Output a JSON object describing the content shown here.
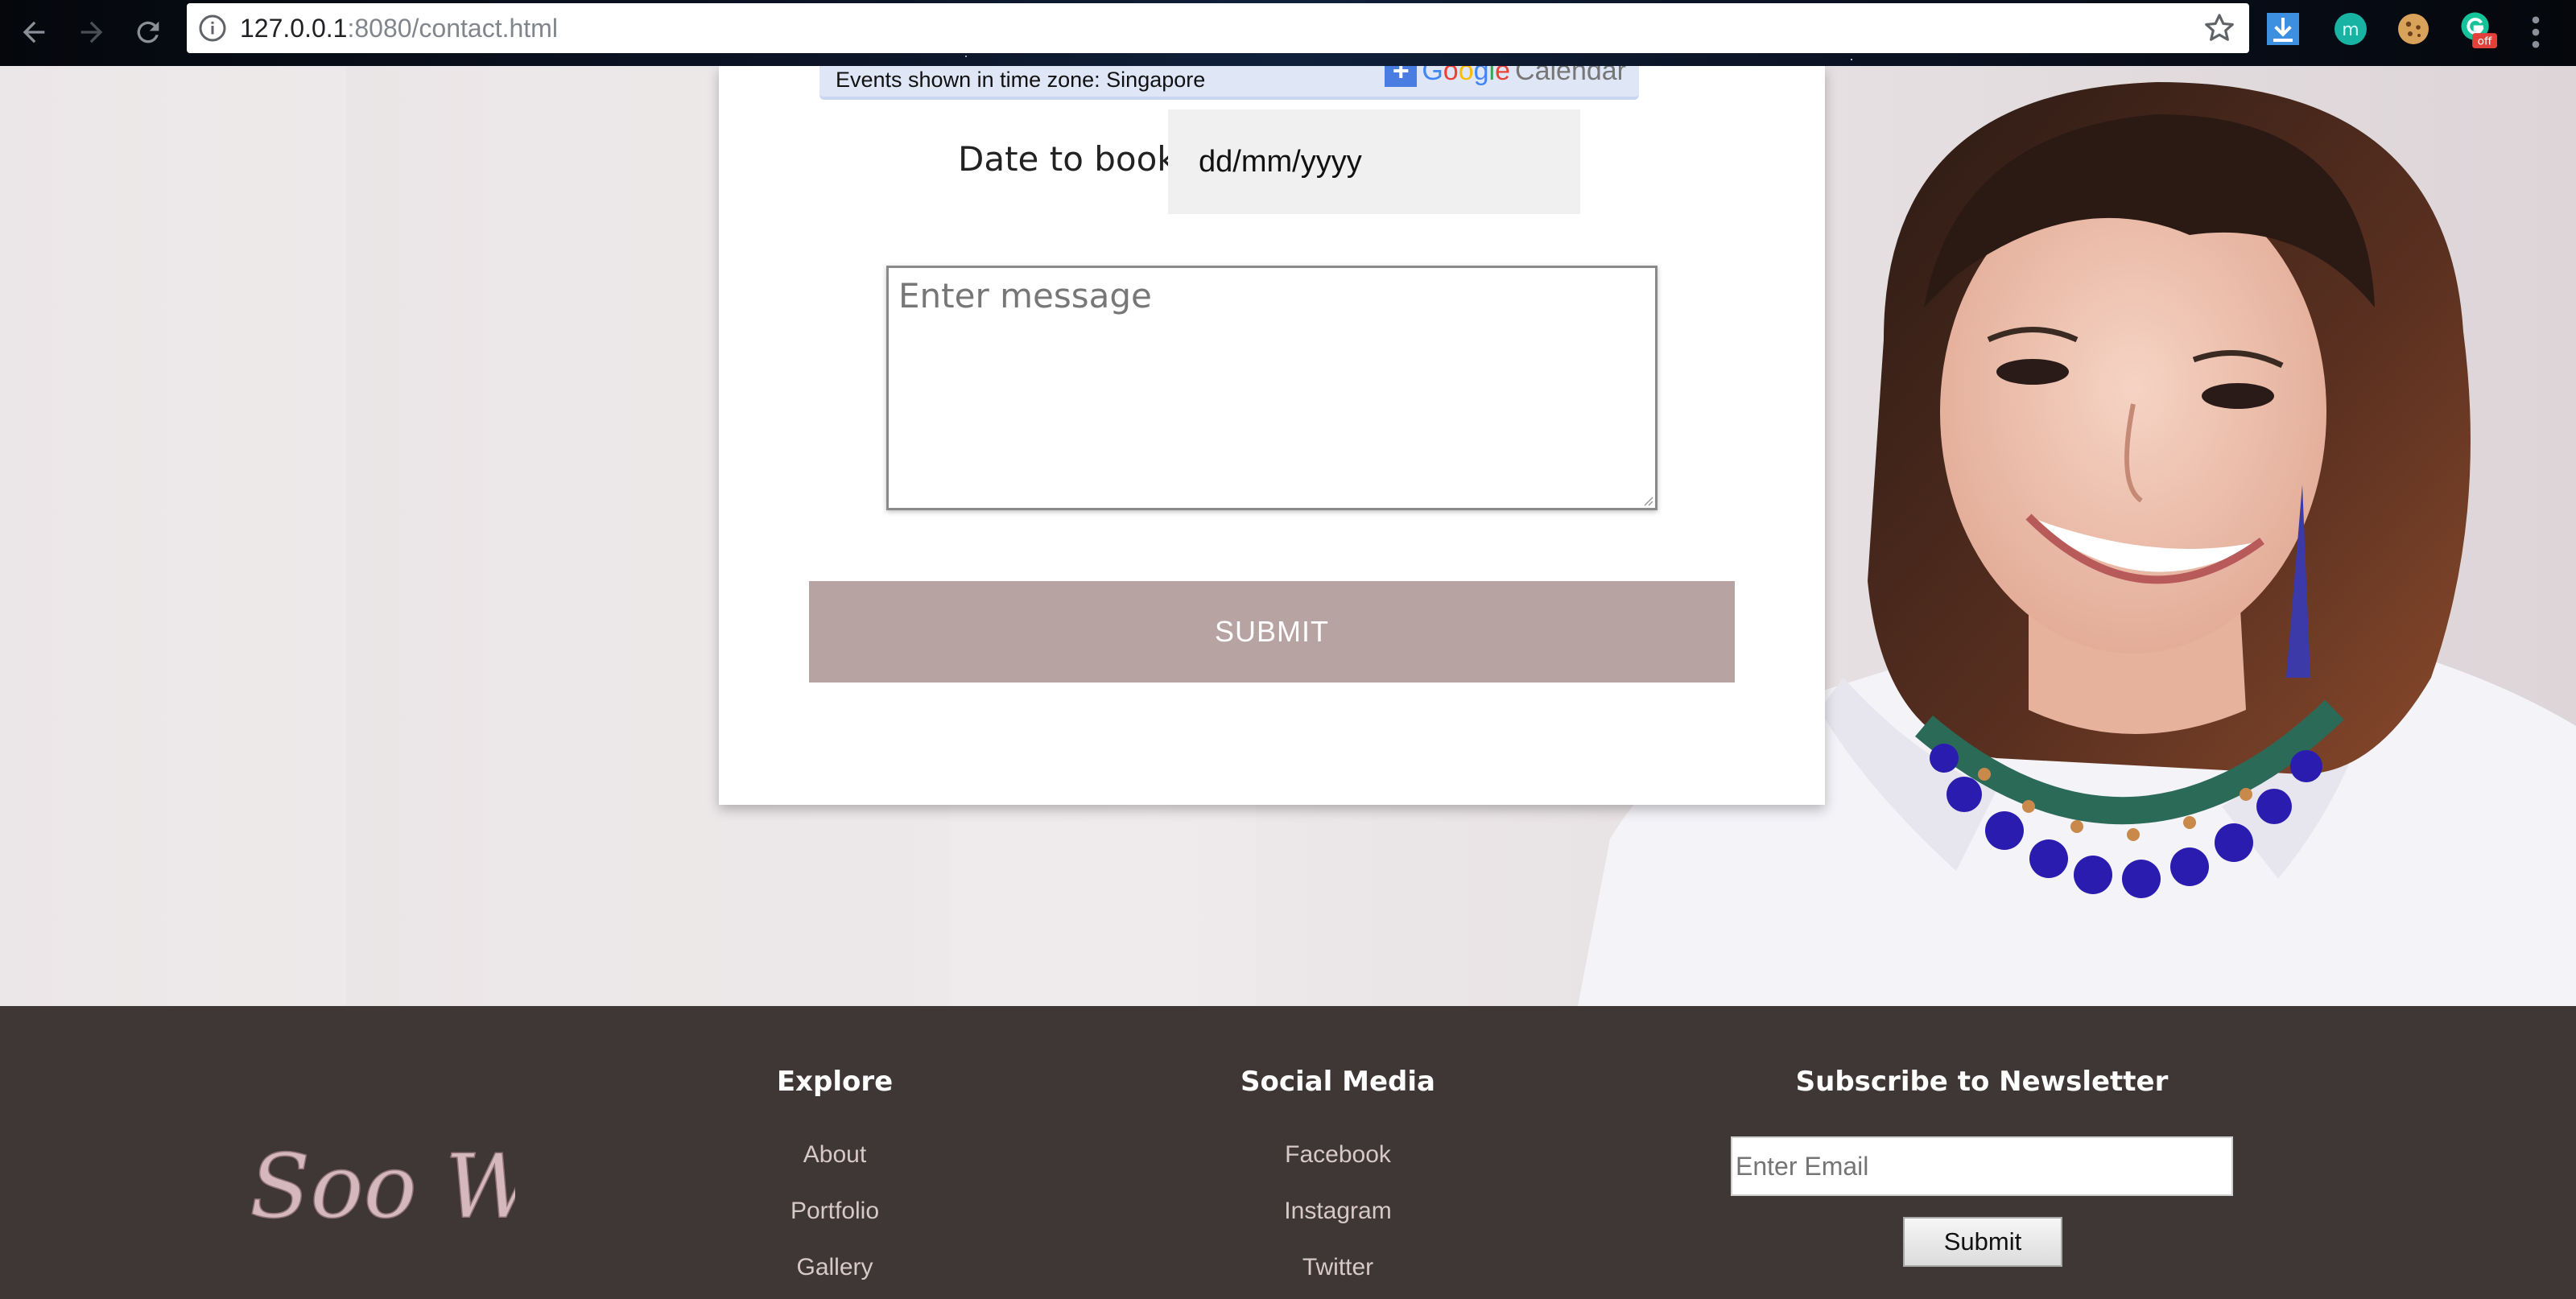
{
  "browser": {
    "url_host": "127.0.0.1",
    "url_rest": ":8080/contact.html",
    "extension_badge": "off"
  },
  "form": {
    "timezone_text": "Events shown in time zone: Singapore",
    "gcal_word": [
      "G",
      "o",
      "o",
      "g",
      "l",
      "e"
    ],
    "gcal_suffix": "Calendar",
    "date_label": "Date to book:",
    "date_value": "dd/mm/yyyy",
    "message_placeholder": "Enter message",
    "submit_label": "SUBMIT"
  },
  "footer": {
    "logo_text": "Soo Wei",
    "explore": {
      "title": "Explore",
      "links": [
        "About",
        "Portfolio",
        "Gallery"
      ]
    },
    "social": {
      "title": "Social Media",
      "links": [
        "Facebook",
        "Instagram",
        "Twitter"
      ]
    },
    "newsletter": {
      "title": "Subscribe to Newsletter",
      "email_placeholder": "Enter Email",
      "submit_label": "Submit"
    }
  },
  "colors": {
    "submit_bg": "#b7a4a2",
    "footer_bg": "#3e3735",
    "footer_link": "#d7c9c7"
  }
}
